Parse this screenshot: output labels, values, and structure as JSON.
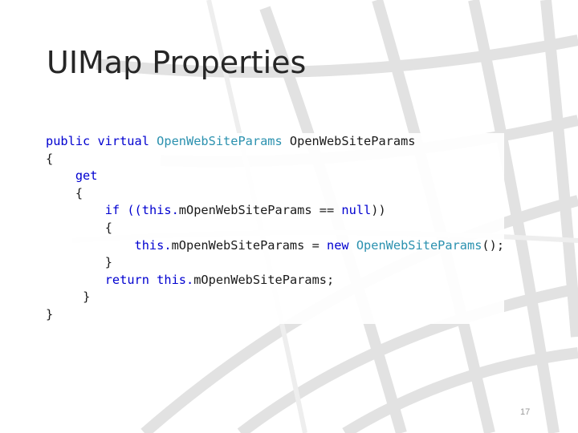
{
  "slide": {
    "title": "UIMap Properties",
    "page_number": "17"
  },
  "code_lines": [
    [
      "",
      "public virtual ",
      "OpenWebSiteParams",
      " OpenWebSiteParams"
    ],
    [
      "",
      "{"
    ],
    [
      "    ",
      "get"
    ],
    [
      "    ",
      "{"
    ],
    [
      "        ",
      "if ((this.",
      "mOpenWebSiteParams",
      " == ",
      "null",
      "))"
    ],
    [
      "        ",
      "{"
    ],
    [
      "            ",
      "this.",
      "mOpenWebSiteParams",
      " = ",
      "new ",
      "OpenWebSiteParams",
      "();"
    ],
    [
      "        ",
      "}"
    ],
    [
      "        ",
      "return ",
      "this.",
      "mOpenWebSiteParams;"
    ],
    [
      "     ",
      "}"
    ],
    [
      "",
      "}"
    ]
  ],
  "colors": {
    "keyword": "#0000d0",
    "type": "#2b91af",
    "text": "#1a1a1a",
    "grid": "#d9d9d9"
  }
}
